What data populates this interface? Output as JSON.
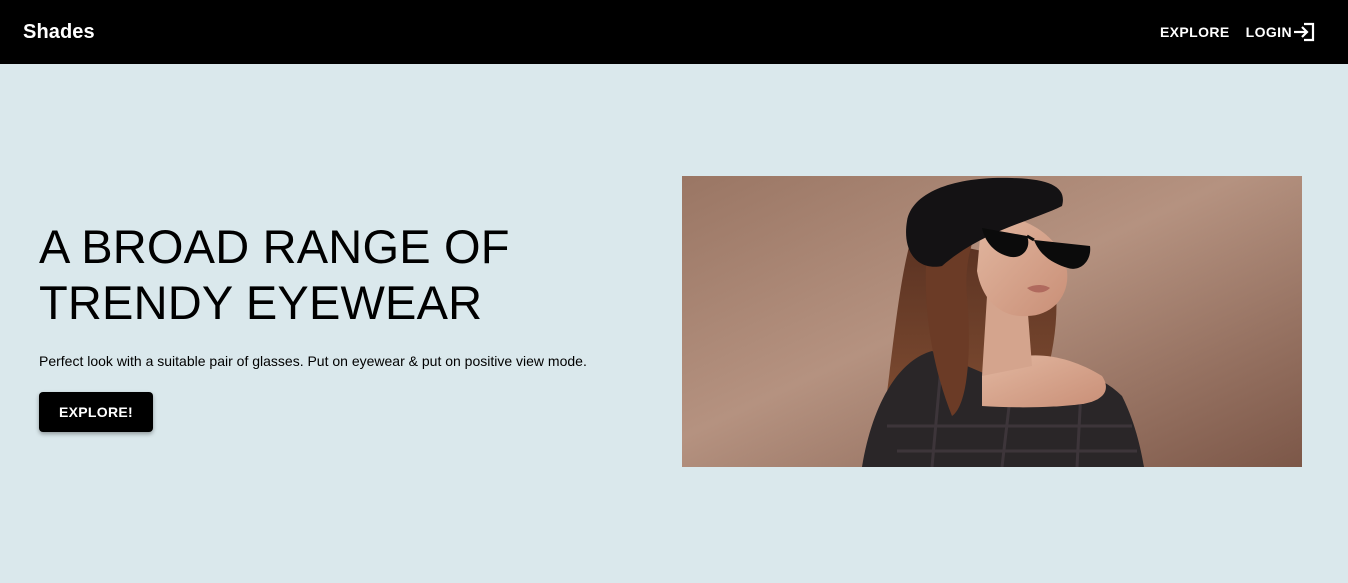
{
  "navbar": {
    "brand": "Shades",
    "explore_label": "EXPLORE",
    "login_label": "LOGIN",
    "login_icon": "login-icon"
  },
  "hero": {
    "headline": "A BROAD RANGE OF TRENDY EYEWEAR",
    "tagline": "Perfect look with a suitable pair of glasses. Put on eyewear & put on positive view mode.",
    "cta_label": "EXPLORE!",
    "image_subject": "woman-in-sunglasses-photo"
  },
  "colors": {
    "navbar_bg": "#000000",
    "page_bg": "#dae8ec",
    "button_bg": "#000000",
    "button_text": "#ffffff"
  }
}
